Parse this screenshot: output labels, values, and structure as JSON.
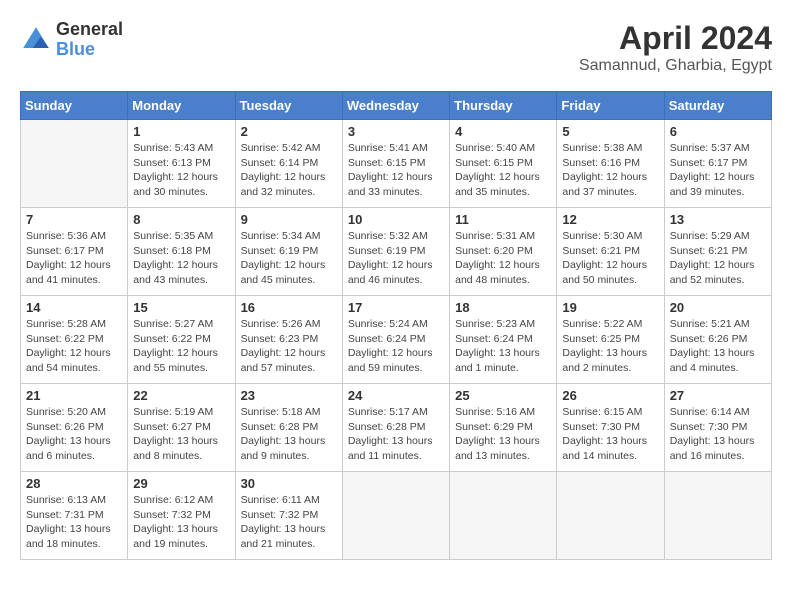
{
  "header": {
    "logo_general": "General",
    "logo_blue": "Blue",
    "month_title": "April 2024",
    "subtitle": "Samannud, Gharbia, Egypt"
  },
  "days_of_week": [
    "Sunday",
    "Monday",
    "Tuesday",
    "Wednesday",
    "Thursday",
    "Friday",
    "Saturday"
  ],
  "weeks": [
    [
      {
        "day": "",
        "info": ""
      },
      {
        "day": "1",
        "info": "Sunrise: 5:43 AM\nSunset: 6:13 PM\nDaylight: 12 hours\nand 30 minutes."
      },
      {
        "day": "2",
        "info": "Sunrise: 5:42 AM\nSunset: 6:14 PM\nDaylight: 12 hours\nand 32 minutes."
      },
      {
        "day": "3",
        "info": "Sunrise: 5:41 AM\nSunset: 6:15 PM\nDaylight: 12 hours\nand 33 minutes."
      },
      {
        "day": "4",
        "info": "Sunrise: 5:40 AM\nSunset: 6:15 PM\nDaylight: 12 hours\nand 35 minutes."
      },
      {
        "day": "5",
        "info": "Sunrise: 5:38 AM\nSunset: 6:16 PM\nDaylight: 12 hours\nand 37 minutes."
      },
      {
        "day": "6",
        "info": "Sunrise: 5:37 AM\nSunset: 6:17 PM\nDaylight: 12 hours\nand 39 minutes."
      }
    ],
    [
      {
        "day": "7",
        "info": "Sunrise: 5:36 AM\nSunset: 6:17 PM\nDaylight: 12 hours\nand 41 minutes."
      },
      {
        "day": "8",
        "info": "Sunrise: 5:35 AM\nSunset: 6:18 PM\nDaylight: 12 hours\nand 43 minutes."
      },
      {
        "day": "9",
        "info": "Sunrise: 5:34 AM\nSunset: 6:19 PM\nDaylight: 12 hours\nand 45 minutes."
      },
      {
        "day": "10",
        "info": "Sunrise: 5:32 AM\nSunset: 6:19 PM\nDaylight: 12 hours\nand 46 minutes."
      },
      {
        "day": "11",
        "info": "Sunrise: 5:31 AM\nSunset: 6:20 PM\nDaylight: 12 hours\nand 48 minutes."
      },
      {
        "day": "12",
        "info": "Sunrise: 5:30 AM\nSunset: 6:21 PM\nDaylight: 12 hours\nand 50 minutes."
      },
      {
        "day": "13",
        "info": "Sunrise: 5:29 AM\nSunset: 6:21 PM\nDaylight: 12 hours\nand 52 minutes."
      }
    ],
    [
      {
        "day": "14",
        "info": "Sunrise: 5:28 AM\nSunset: 6:22 PM\nDaylight: 12 hours\nand 54 minutes."
      },
      {
        "day": "15",
        "info": "Sunrise: 5:27 AM\nSunset: 6:22 PM\nDaylight: 12 hours\nand 55 minutes."
      },
      {
        "day": "16",
        "info": "Sunrise: 5:26 AM\nSunset: 6:23 PM\nDaylight: 12 hours\nand 57 minutes."
      },
      {
        "day": "17",
        "info": "Sunrise: 5:24 AM\nSunset: 6:24 PM\nDaylight: 12 hours\nand 59 minutes."
      },
      {
        "day": "18",
        "info": "Sunrise: 5:23 AM\nSunset: 6:24 PM\nDaylight: 13 hours\nand 1 minute."
      },
      {
        "day": "19",
        "info": "Sunrise: 5:22 AM\nSunset: 6:25 PM\nDaylight: 13 hours\nand 2 minutes."
      },
      {
        "day": "20",
        "info": "Sunrise: 5:21 AM\nSunset: 6:26 PM\nDaylight: 13 hours\nand 4 minutes."
      }
    ],
    [
      {
        "day": "21",
        "info": "Sunrise: 5:20 AM\nSunset: 6:26 PM\nDaylight: 13 hours\nand 6 minutes."
      },
      {
        "day": "22",
        "info": "Sunrise: 5:19 AM\nSunset: 6:27 PM\nDaylight: 13 hours\nand 8 minutes."
      },
      {
        "day": "23",
        "info": "Sunrise: 5:18 AM\nSunset: 6:28 PM\nDaylight: 13 hours\nand 9 minutes."
      },
      {
        "day": "24",
        "info": "Sunrise: 5:17 AM\nSunset: 6:28 PM\nDaylight: 13 hours\nand 11 minutes."
      },
      {
        "day": "25",
        "info": "Sunrise: 5:16 AM\nSunset: 6:29 PM\nDaylight: 13 hours\nand 13 minutes."
      },
      {
        "day": "26",
        "info": "Sunrise: 6:15 AM\nSunset: 7:30 PM\nDaylight: 13 hours\nand 14 minutes."
      },
      {
        "day": "27",
        "info": "Sunrise: 6:14 AM\nSunset: 7:30 PM\nDaylight: 13 hours\nand 16 minutes."
      }
    ],
    [
      {
        "day": "28",
        "info": "Sunrise: 6:13 AM\nSunset: 7:31 PM\nDaylight: 13 hours\nand 18 minutes."
      },
      {
        "day": "29",
        "info": "Sunrise: 6:12 AM\nSunset: 7:32 PM\nDaylight: 13 hours\nand 19 minutes."
      },
      {
        "day": "30",
        "info": "Sunrise: 6:11 AM\nSunset: 7:32 PM\nDaylight: 13 hours\nand 21 minutes."
      },
      {
        "day": "",
        "info": ""
      },
      {
        "day": "",
        "info": ""
      },
      {
        "day": "",
        "info": ""
      },
      {
        "day": "",
        "info": ""
      }
    ]
  ]
}
